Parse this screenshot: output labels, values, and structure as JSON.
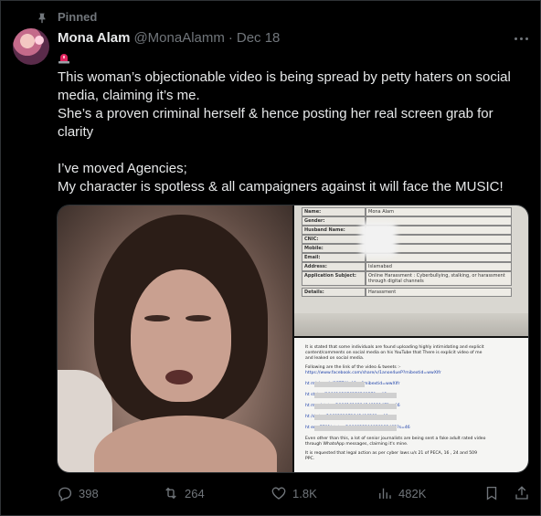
{
  "pinned_label": "Pinned",
  "author": {
    "name": "Mona Alam",
    "handle": "@MonaAlamm",
    "separator": "·",
    "date": "Dec 18"
  },
  "emoji": "rotating-light-icon",
  "text": {
    "line1": "This woman’s objectionable video is being spread by petty haters on social",
    "line2": "media, claiming it’s me.",
    "line3": "She’s a proven criminal herself & hence posting her real screen grab for",
    "line4": "clarity",
    "line5": "I’ve moved Agencies;",
    "line6": "My character is spotless & all campaigners against it will face the MUSIC!"
  },
  "media": {
    "form": {
      "rows": [
        {
          "label": "Name:",
          "value": "Mona Alam"
        },
        {
          "label": "Gender:",
          "value": ""
        },
        {
          "label": "Husband Name:",
          "value": ""
        },
        {
          "label": "CNIC:",
          "value": ""
        },
        {
          "label": "Mobile:",
          "value": ""
        },
        {
          "label": "Email:",
          "value": ""
        },
        {
          "label": "Address:",
          "value": "Islamabad"
        },
        {
          "label": "Application Subject:",
          "value": "Online Harassment : Cyberbullying, stalking, or harassment through digital channels"
        },
        {
          "label": "Details:",
          "value": "Harassment"
        }
      ]
    },
    "letter": {
      "p1": "It is stated that some individuals are found uploading highly intimidating and explicit",
      "p1b": "content/comments on social media on his YouTube that There is explicit video of me",
      "p1c": "and leaked on social media.",
      "p2": "Following are the link of the video & tweets :-",
      "p2b": "https://www.facebook.com/share/v/1anoe4ueP?mibextid=wwXIfr",
      "links": [
        "ht                          m/share/p/15TFWnA8gg?mibextid=wwXIfr",
        "ht                                    status/186619587627626857?s=46",
        "ht                                    man/status/1866181021424812147?s=46",
        "ht                                    /status/186823137184249639?s=46",
        "ht                                    em_7701/status/1866822200858132482?s=46"
      ],
      "p3": "Even other than this, a lot of senior journalists are being sent a fake adult rated video",
      "p3b": "through WhatsApp messages, claiming it's mine.",
      "p4": "It is requested that legal action as per cyber laws u/s 21 of PECA, 16 , 24 and 509",
      "p4b": "PPC."
    }
  },
  "actions": {
    "replies": "398",
    "reposts": "264",
    "likes": "1.8K",
    "views": "482K"
  },
  "colors": {
    "background": "#000000",
    "text": "#e7e9ea",
    "muted": "#71767b",
    "border": "#2f3336"
  }
}
